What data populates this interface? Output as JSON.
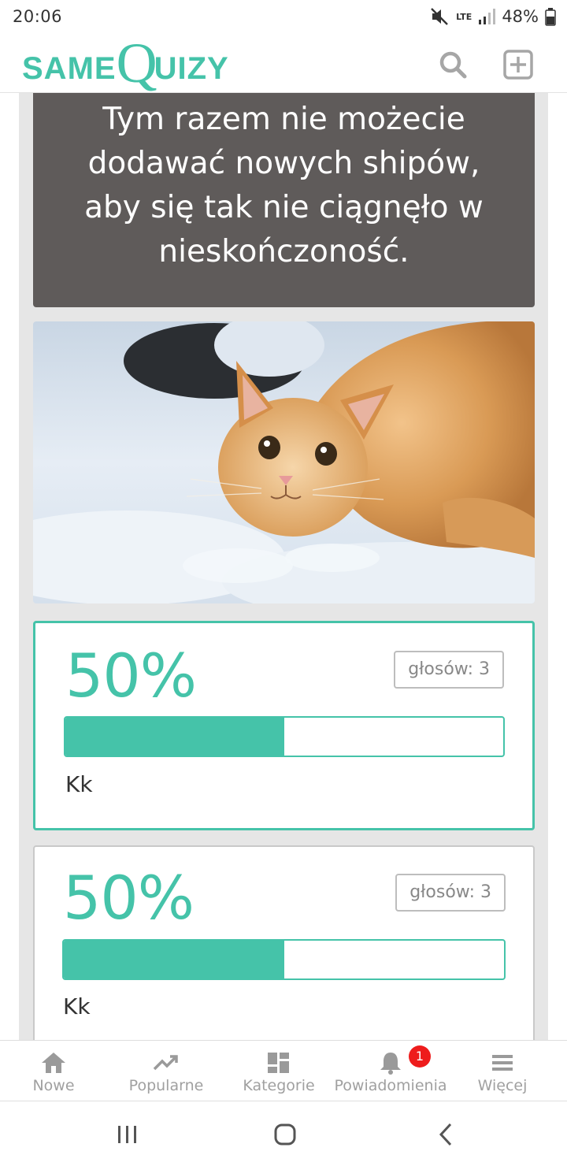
{
  "status_bar": {
    "time": "20:06",
    "network": "LTE",
    "battery": "48%"
  },
  "header": {
    "logo_same": "SAME",
    "logo_q": "Q",
    "logo_uizy": "UIZY",
    "search_icon": "search-icon",
    "add_icon": "add-icon"
  },
  "banner": {
    "lines": [
      "Tym razem nie możecie",
      "dodawać nowych shipów,",
      "aby się tak nie ciągnęło w",
      "nieskończoność."
    ]
  },
  "answers": [
    {
      "percent": "50%",
      "votes": "głosów: 3",
      "label": "Kk",
      "fill": 0.5
    },
    {
      "percent": "50%",
      "votes": "głosów: 3",
      "label": "Kk",
      "fill": 0.5
    }
  ],
  "bottom_nav": {
    "items": [
      {
        "label": "Nowe",
        "icon": "home-icon"
      },
      {
        "label": "Popularne",
        "icon": "trending-icon"
      },
      {
        "label": "Kategorie",
        "icon": "dashboard-icon"
      },
      {
        "label": "Powiadomienia",
        "icon": "bell-icon",
        "badge": "1"
      },
      {
        "label": "Więcej",
        "icon": "menu-icon"
      }
    ]
  },
  "colors": {
    "accent": "#45c3a9",
    "banner_bg": "#5f5b5a",
    "badge": "#ee1c1c"
  }
}
